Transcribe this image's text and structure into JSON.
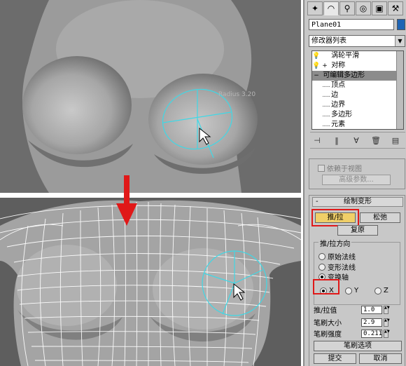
{
  "viewport": {
    "brush_label": "Radius 3.20"
  },
  "panel": {
    "tabs": [
      {
        "icon": "create-icon"
      },
      {
        "icon": "modify-icon"
      },
      {
        "icon": "hierarchy-icon"
      },
      {
        "icon": "motion-icon"
      },
      {
        "icon": "display-icon"
      },
      {
        "icon": "utilities-icon"
      }
    ],
    "object_name": "Plane01",
    "object_color": "#1e64b4",
    "modifier_list": "修改器列表",
    "stack": [
      {
        "label": "涡轮平滑",
        "type": "modifier",
        "icon": "bulb-icon"
      },
      {
        "label": "对称",
        "type": "modifier",
        "icon": "bulb-icon",
        "expand": "+"
      },
      {
        "label": "可编辑多边形",
        "type": "base",
        "expand": "−"
      },
      {
        "label": "顶点",
        "type": "sub"
      },
      {
        "label": "边",
        "type": "sub"
      },
      {
        "label": "边界",
        "type": "sub"
      },
      {
        "label": "多边形",
        "type": "sub"
      },
      {
        "label": "元素",
        "type": "sub"
      }
    ],
    "selection": {
      "depend_on_view": "依赖于视图",
      "advanced": "高级参数..."
    },
    "deform": {
      "title": "绘制变形",
      "collapse": "-",
      "push_pull": "推/拉",
      "relax": "松弛",
      "revert": "复原",
      "direction_title": "推/拉方向",
      "original_normals": "原始法线",
      "deformed_normals": "变形法线",
      "transform_axis": "变换轴",
      "axis_x": "X",
      "axis_y": "Y",
      "axis_z": "Z",
      "push_pull_value_label": "推/拉值",
      "push_pull_value": "1.0",
      "brush_size_label": "笔刷大小",
      "brush_size": "2.9",
      "brush_strength_label": "笔刷强度",
      "brush_strength": "0.211",
      "brush_options": "笔刷选项",
      "commit": "提交",
      "cancel": "取消"
    },
    "accent_red": "#e01818",
    "active_button_color": "#f0cf68"
  }
}
